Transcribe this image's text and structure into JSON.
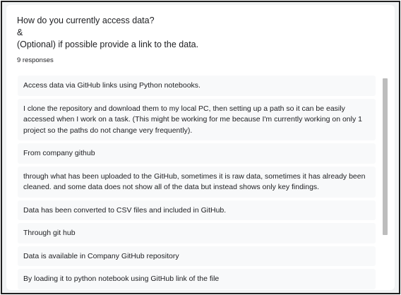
{
  "question": {
    "line1": "How do you currently access data?",
    "line2": "&",
    "line3": "(Optional) if possible provide a link to the data."
  },
  "responses_count": "9 responses",
  "responses": [
    "Access data via GitHub links using Python notebooks.",
    "I clone the repository and download them to my local PC, then setting up a path so it can be easily accessed when I work on a task. (This might be working for me because I'm currently working on only 1 project so the paths do not change very frequently).",
    "From company github",
    "through what has been uploaded to the GitHub, sometimes it is raw data, sometimes it has already been cleaned. and some data does not show all of the data but instead shows only key findings.",
    "Data has been converted to CSV files and included in GitHub.",
    "Through git hub",
    "Data is available in Company GitHub repository",
    "By loading it to python notebook using GitHub link of the file"
  ]
}
